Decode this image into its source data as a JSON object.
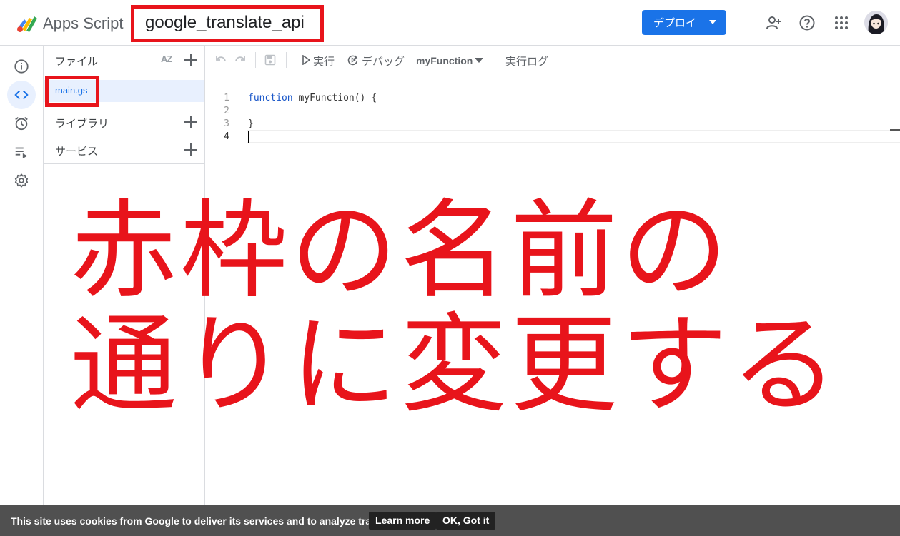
{
  "header": {
    "app_name": "Apps Script",
    "project_name": "google_translate_api",
    "deploy_label": "デプロイ",
    "icons": [
      "add-person-icon",
      "help-icon",
      "apps-grid-icon"
    ],
    "accent_color": "#1a73e8",
    "highlight_color": "#e8141b"
  },
  "rail": {
    "items": [
      {
        "name": "info-icon"
      },
      {
        "name": "code-icon",
        "active": true
      },
      {
        "name": "alarm-icon"
      },
      {
        "name": "executions-icon"
      },
      {
        "name": "settings-icon"
      }
    ]
  },
  "files_panel": {
    "files_label": "ファイル",
    "sort_label": "AZ",
    "file_name": "main.gs",
    "libraries_label": "ライブラリ",
    "services_label": "サービス"
  },
  "toolbar": {
    "run_label": "実行",
    "debug_label": "デバッグ",
    "function_select": "myFunction",
    "log_label": "実行ログ"
  },
  "editor": {
    "lines": [
      {
        "num": "1",
        "keyword": "function",
        "rest": " myFunction() {"
      },
      {
        "num": "2",
        "keyword": "",
        "rest": ""
      },
      {
        "num": "3",
        "keyword": "",
        "rest": "}"
      },
      {
        "num": "4",
        "keyword": "",
        "rest": ""
      }
    ]
  },
  "overlay": {
    "line1": "赤枠の名前の",
    "line2": "通りに変更する"
  },
  "cookie_bar": {
    "message": "This site uses cookies from Google to deliver its services and to analyze traffic.",
    "learn_more": "Learn more",
    "ok": "OK, Got it"
  }
}
